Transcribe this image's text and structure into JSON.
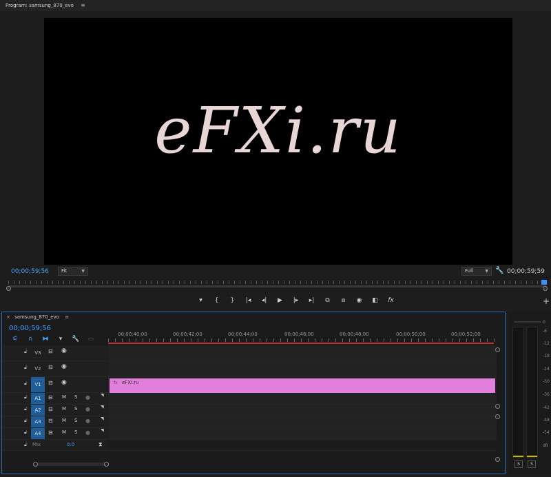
{
  "program": {
    "title": "Program: samsung_870_evo",
    "menu_icon": "hamburger-icon",
    "overlay_text": "eFXi.ru",
    "timecode_in": "00;00;59;56",
    "fit": "Fit",
    "quality": "Full",
    "timecode_out": "00;00;59;59",
    "transport_icons": [
      "marker-icon",
      "mark-in-icon",
      "mark-out-icon",
      "go-to-in-icon",
      "step-back-icon",
      "play-icon",
      "step-forward-icon",
      "go-to-out-icon",
      "insert-icon",
      "overwrite-icon",
      "export-frame-icon",
      "comparison-view-icon",
      "fx-icon"
    ],
    "transport_glyphs": [
      "▾",
      "{",
      "}",
      "|◂",
      "◂|",
      "▶",
      "|▸",
      "▸|",
      "⧉",
      "⧈",
      "◉",
      "◧",
      "fx"
    ],
    "add_button": "+"
  },
  "timeline": {
    "tab_title": "samsung_870_evo",
    "timecode": "00;00;59;56",
    "ruler_labels": [
      "00;00;40;00",
      "00;00;42;00",
      "00;00;44;00",
      "00;00;46;00",
      "00;00;48;00",
      "00;00;50;00",
      "00;00;52;00"
    ],
    "video_tracks": [
      "V3",
      "V2",
      "V1"
    ],
    "audio_tracks": [
      "A1",
      "A2",
      "A3",
      "A4"
    ],
    "track_buttons": {
      "mute": "M",
      "solo": "S"
    },
    "mix_label": "Mix",
    "mix_value": "0.0",
    "clip": {
      "name": "eFXi.ru",
      "fx": "fx",
      "color": "#e27fdc"
    }
  },
  "meter": {
    "scale": [
      "0",
      "-6",
      "-12",
      "-18",
      "-24",
      "-30",
      "-36",
      "-42",
      "-48",
      "-54",
      "dB"
    ],
    "solo_left": "S",
    "solo_right": "S"
  },
  "colors": {
    "accent": "#4aa3ff",
    "playhead_line": "#c8322f",
    "active_track": "#1f5d99"
  }
}
